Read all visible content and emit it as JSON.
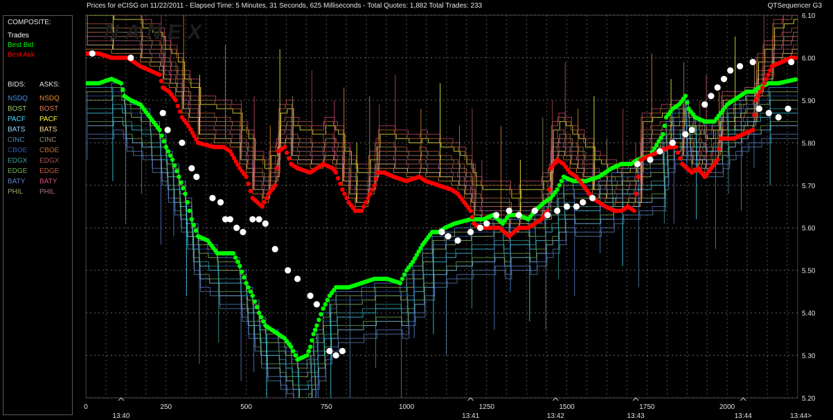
{
  "header": {
    "title": "Prices for  eCISG  on  11/22/2011  -  Elapsed Time: 5 Minutes, 31 Seconds, 625 Milliseconds  -  Total Quotes: 1,882  Total Trades: 233",
    "app_name": "QTSequencer G3"
  },
  "watermark": "NANEX",
  "legend": {
    "composite_heading": "COMPOSITE:",
    "composite": [
      {
        "label": "Trades",
        "color": "#ffffff"
      },
      {
        "label": "Best Bid",
        "color": "#00ff00"
      },
      {
        "label": "Best Ask",
        "color": "#ff0000"
      }
    ],
    "bids_heading": "BIDS:",
    "asks_heading": "ASKS:",
    "exchanges": [
      {
        "bid": "NSDQ",
        "ask": "NSDQ",
        "bid_color": "#4a90e8",
        "ask_color": "#e8902a"
      },
      {
        "bid": "BOST",
        "ask": "BOST",
        "bid_color": "#9acd70",
        "ask_color": "#e07a5a"
      },
      {
        "bid": "PACF",
        "ask": "PACF",
        "bid_color": "#40e0ff",
        "ask_color": "#ffff40"
      },
      {
        "bid": "BATS",
        "ask": "BATS",
        "bid_color": "#8fd8ff",
        "ask_color": "#ffd890"
      },
      {
        "bid": "CINC",
        "ask": "CINC",
        "bid_color": "#5a8ab8",
        "ask_color": "#a09070"
      },
      {
        "bid": "CBOE",
        "ask": "CBOE",
        "bid_color": "#2a5ab0",
        "ask_color": "#c07030"
      },
      {
        "bid": "EDGX",
        "ask": "EDGX",
        "bid_color": "#3aa0a0",
        "ask_color": "#b05050"
      },
      {
        "bid": "EDGE",
        "ask": "EDGE",
        "bid_color": "#70b050",
        "ask_color": "#c06040"
      },
      {
        "bid": "BATY",
        "ask": "BATY",
        "bid_color": "#6080d0",
        "ask_color": "#d05070"
      },
      {
        "bid": "PHIL",
        "ask": "PHIL",
        "bid_color": "#90b060",
        "ask_color": "#b07090"
      }
    ]
  },
  "chart_data": {
    "type": "line",
    "ylim": [
      5.2,
      6.1
    ],
    "y_ticks": [
      "6.10",
      "6.00",
      "5.90",
      "5.80",
      "5.70",
      "5.60",
      "5.50",
      "5.40",
      "5.30",
      "5.20"
    ],
    "xlim": [
      0,
      2220
    ],
    "x_ticks": [
      "0",
      "250",
      "500",
      "750",
      "1000",
      "1250",
      "1500",
      "1750",
      "2000"
    ],
    "time_labels": [
      {
        "x": 110,
        "label": "13:40"
      },
      {
        "x": 1200,
        "label": "13:41"
      },
      {
        "x": 1465,
        "label": "13:42"
      },
      {
        "x": 1715,
        "label": "13:43"
      },
      {
        "x": 2050,
        "label": "13:44"
      },
      {
        "x": 2225,
        "label": "13:44>"
      }
    ],
    "grid": true,
    "series": [
      {
        "name": "Best Ask",
        "points": [
          [
            0,
            6.01
          ],
          [
            40,
            6.01
          ],
          [
            80,
            6.0
          ],
          [
            130,
            6.0
          ],
          [
            170,
            5.98
          ],
          [
            200,
            5.97
          ],
          [
            230,
            5.96
          ],
          [
            240,
            5.93
          ],
          [
            260,
            5.92
          ],
          [
            280,
            5.9
          ],
          [
            300,
            5.86
          ],
          [
            320,
            5.84
          ],
          [
            350,
            5.8
          ],
          [
            400,
            5.79
          ],
          [
            430,
            5.79
          ],
          [
            450,
            5.78
          ],
          [
            480,
            5.74
          ],
          [
            500,
            5.72
          ],
          [
            520,
            5.67
          ],
          [
            550,
            5.65
          ],
          [
            570,
            5.68
          ],
          [
            590,
            5.7
          ],
          [
            600,
            5.78
          ],
          [
            620,
            5.79
          ],
          [
            640,
            5.75
          ],
          [
            660,
            5.74
          ],
          [
            700,
            5.73
          ],
          [
            740,
            5.75
          ],
          [
            770,
            5.74
          ],
          [
            780,
            5.73
          ],
          [
            800,
            5.69
          ],
          [
            820,
            5.66
          ],
          [
            840,
            5.64
          ],
          [
            860,
            5.64
          ],
          [
            880,
            5.67
          ],
          [
            900,
            5.7
          ],
          [
            910,
            5.73
          ],
          [
            930,
            5.73
          ],
          [
            960,
            5.72
          ],
          [
            1000,
            5.71
          ],
          [
            1040,
            5.72
          ],
          [
            1060,
            5.71
          ],
          [
            1100,
            5.7
          ],
          [
            1140,
            5.69
          ],
          [
            1160,
            5.68
          ],
          [
            1180,
            5.66
          ],
          [
            1200,
            5.64
          ],
          [
            1210,
            5.61
          ],
          [
            1230,
            5.6
          ],
          [
            1260,
            5.6
          ],
          [
            1290,
            5.6
          ],
          [
            1320,
            5.58
          ],
          [
            1350,
            5.6
          ],
          [
            1380,
            5.6
          ],
          [
            1420,
            5.62
          ],
          [
            1440,
            5.64
          ],
          [
            1450,
            5.74
          ],
          [
            1470,
            5.76
          ],
          [
            1490,
            5.75
          ],
          [
            1510,
            5.73
          ],
          [
            1530,
            5.72
          ],
          [
            1550,
            5.7
          ],
          [
            1580,
            5.67
          ],
          [
            1600,
            5.66
          ],
          [
            1620,
            5.65
          ],
          [
            1650,
            5.64
          ],
          [
            1670,
            5.64
          ],
          [
            1690,
            5.65
          ],
          [
            1710,
            5.64
          ],
          [
            1730,
            5.76
          ],
          [
            1760,
            5.77
          ],
          [
            1790,
            5.78
          ],
          [
            1820,
            5.79
          ],
          [
            1840,
            5.79
          ],
          [
            1860,
            5.75
          ],
          [
            1890,
            5.73
          ],
          [
            1910,
            5.74
          ],
          [
            1920,
            5.73
          ],
          [
            1930,
            5.72
          ],
          [
            1950,
            5.74
          ],
          [
            1970,
            5.76
          ],
          [
            1980,
            5.81
          ],
          [
            2020,
            5.81
          ],
          [
            2050,
            5.82
          ],
          [
            2080,
            5.83
          ],
          [
            2090,
            5.9
          ],
          [
            2110,
            5.93
          ],
          [
            2140,
            5.98
          ],
          [
            2170,
            5.99
          ],
          [
            2200,
            6.0
          ],
          [
            2220,
            6.0
          ]
        ]
      },
      {
        "name": "Best Bid",
        "points": [
          [
            0,
            5.94
          ],
          [
            40,
            5.94
          ],
          [
            80,
            5.95
          ],
          [
            110,
            5.94
          ],
          [
            120,
            5.91
          ],
          [
            140,
            5.9
          ],
          [
            170,
            5.89
          ],
          [
            200,
            5.86
          ],
          [
            230,
            5.83
          ],
          [
            250,
            5.79
          ],
          [
            270,
            5.76
          ],
          [
            290,
            5.72
          ],
          [
            310,
            5.68
          ],
          [
            330,
            5.62
          ],
          [
            350,
            5.58
          ],
          [
            380,
            5.57
          ],
          [
            410,
            5.54
          ],
          [
            460,
            5.54
          ],
          [
            480,
            5.51
          ],
          [
            500,
            5.47
          ],
          [
            520,
            5.44
          ],
          [
            540,
            5.4
          ],
          [
            560,
            5.37
          ],
          [
            600,
            5.35
          ],
          [
            620,
            5.34
          ],
          [
            640,
            5.32
          ],
          [
            660,
            5.29
          ],
          [
            690,
            5.3
          ],
          [
            700,
            5.32
          ],
          [
            710,
            5.35
          ],
          [
            720,
            5.37
          ],
          [
            740,
            5.41
          ],
          [
            760,
            5.44
          ],
          [
            780,
            5.46
          ],
          [
            820,
            5.46
          ],
          [
            860,
            5.47
          ],
          [
            900,
            5.48
          ],
          [
            940,
            5.48
          ],
          [
            980,
            5.47
          ],
          [
            1000,
            5.5
          ],
          [
            1020,
            5.52
          ],
          [
            1050,
            5.56
          ],
          [
            1080,
            5.59
          ],
          [
            1100,
            5.59
          ],
          [
            1120,
            5.6
          ],
          [
            1150,
            5.61
          ],
          [
            1200,
            5.62
          ],
          [
            1240,
            5.62
          ],
          [
            1270,
            5.63
          ],
          [
            1300,
            5.61
          ],
          [
            1320,
            5.63
          ],
          [
            1350,
            5.63
          ],
          [
            1380,
            5.62
          ],
          [
            1400,
            5.64
          ],
          [
            1430,
            5.66
          ],
          [
            1450,
            5.67
          ],
          [
            1470,
            5.69
          ],
          [
            1490,
            5.72
          ],
          [
            1520,
            5.71
          ],
          [
            1560,
            5.71
          ],
          [
            1600,
            5.72
          ],
          [
            1640,
            5.74
          ],
          [
            1670,
            5.75
          ],
          [
            1700,
            5.75
          ],
          [
            1720,
            5.76
          ],
          [
            1760,
            5.77
          ],
          [
            1800,
            5.82
          ],
          [
            1810,
            5.86
          ],
          [
            1830,
            5.88
          ],
          [
            1850,
            5.89
          ],
          [
            1870,
            5.91
          ],
          [
            1880,
            5.88
          ],
          [
            1900,
            5.86
          ],
          [
            1930,
            5.85
          ],
          [
            1960,
            5.85
          ],
          [
            1980,
            5.87
          ],
          [
            2000,
            5.89
          ],
          [
            2020,
            5.9
          ],
          [
            2040,
            5.91
          ],
          [
            2060,
            5.92
          ],
          [
            2080,
            5.92
          ],
          [
            2100,
            5.93
          ],
          [
            2130,
            5.94
          ],
          [
            2160,
            5.94
          ],
          [
            2220,
            5.95
          ]
        ]
      },
      {
        "name": "Trades",
        "points": [
          [
            20,
            6.01
          ],
          [
            140,
            6.0
          ],
          [
            240,
            5.87
          ],
          [
            255,
            5.83
          ],
          [
            300,
            5.8
          ],
          [
            330,
            5.74
          ],
          [
            345,
            5.72
          ],
          [
            395,
            5.67
          ],
          [
            420,
            5.66
          ],
          [
            435,
            5.62
          ],
          [
            450,
            5.62
          ],
          [
            470,
            5.6
          ],
          [
            490,
            5.59
          ],
          [
            520,
            5.62
          ],
          [
            540,
            5.62
          ],
          [
            560,
            5.61
          ],
          [
            590,
            5.55
          ],
          [
            630,
            5.5
          ],
          [
            660,
            5.48
          ],
          [
            700,
            5.44
          ],
          [
            720,
            5.42
          ],
          [
            760,
            5.31
          ],
          [
            780,
            5.3
          ],
          [
            800,
            5.31
          ],
          [
            1110,
            5.59
          ],
          [
            1130,
            5.58
          ],
          [
            1160,
            5.57
          ],
          [
            1200,
            5.59
          ],
          [
            1230,
            5.6
          ],
          [
            1250,
            5.61
          ],
          [
            1280,
            5.63
          ],
          [
            1320,
            5.64
          ],
          [
            1350,
            5.63
          ],
          [
            1400,
            5.64
          ],
          [
            1440,
            5.63
          ],
          [
            1470,
            5.64
          ],
          [
            1500,
            5.65
          ],
          [
            1530,
            5.65
          ],
          [
            1550,
            5.66
          ],
          [
            1580,
            5.67
          ],
          [
            1720,
            5.75
          ],
          [
            1760,
            5.76
          ],
          [
            1790,
            5.78
          ],
          [
            1830,
            5.8
          ],
          [
            1870,
            5.82
          ],
          [
            1890,
            5.83
          ],
          [
            1930,
            5.89
          ],
          [
            1950,
            5.91
          ],
          [
            1970,
            5.93
          ],
          [
            1990,
            5.95
          ],
          [
            2010,
            5.97
          ],
          [
            2040,
            5.98
          ],
          [
            2080,
            5.99
          ],
          [
            2100,
            5.88
          ],
          [
            2130,
            5.87
          ],
          [
            2160,
            5.86
          ],
          [
            2190,
            5.88
          ],
          [
            2200,
            5.99
          ]
        ]
      }
    ]
  }
}
